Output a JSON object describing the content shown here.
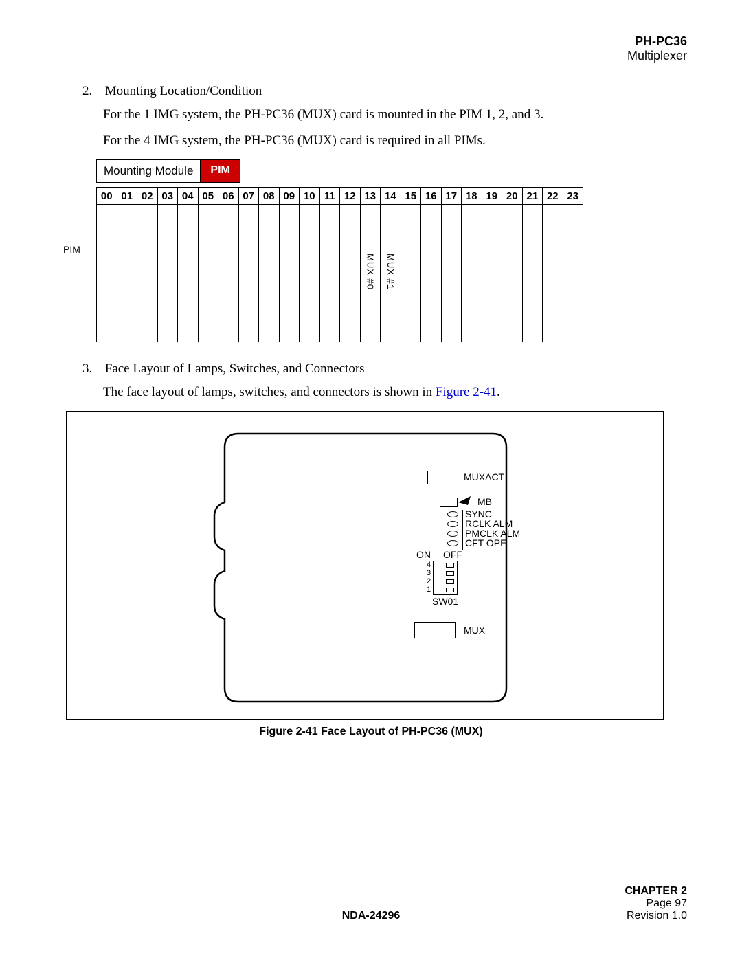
{
  "header": {
    "title": "PH-PC36",
    "subtitle": "Multiplexer"
  },
  "sections": {
    "s2_num": "2.",
    "s2_title": "Mounting Location/Condition",
    "s2_p1": "For the 1 IMG system, the PH-PC36 (MUX) card is mounted in the PIM 1, 2, and 3.",
    "s2_p2": "For the 4 IMG system, the PH-PC36 (MUX) card is required in all PIMs.",
    "s3_num": "3.",
    "s3_title": "Face Layout of Lamps, Switches, and Connectors",
    "s3_p1_a": "The face layout of lamps, switches, and connectors is shown in ",
    "s3_p1_link": "Figure 2-41",
    "s3_p1_b": "."
  },
  "slot_table": {
    "mounting_label": "Mounting Module",
    "pim_badge": "PIM",
    "side_label": "PIM",
    "headers": [
      "00",
      "01",
      "02",
      "03",
      "04",
      "05",
      "06",
      "07",
      "08",
      "09",
      "10",
      "11",
      "12",
      "13",
      "14",
      "15",
      "16",
      "17",
      "18",
      "19",
      "20",
      "21",
      "22",
      "23"
    ],
    "cells": [
      "",
      "",
      "",
      "",
      "",
      "",
      "",
      "",
      "",
      "",
      "",
      "",
      "",
      "MUX #0",
      "MUX #1",
      "",
      "",
      "",
      "",
      "",
      "",
      "",
      "",
      ""
    ]
  },
  "figure": {
    "caption": "Figure 2-41   Face Layout of  PH-PC36 (MUX)",
    "labels": {
      "muxact": "MUXACT",
      "mb": "MB",
      "sync": "SYNC",
      "rclk": "RCLK ALM",
      "pmclk": "PMCLK ALM",
      "cft": "CFT OPE",
      "on": "ON",
      "off": "OFF",
      "sw": "SW01",
      "dip": [
        "4",
        "3",
        "2",
        "1"
      ],
      "mux": "MUX"
    }
  },
  "footer": {
    "doc": "NDA-24296",
    "chapter": "CHAPTER 2",
    "page": "Page 97",
    "rev": "Revision 1.0"
  }
}
